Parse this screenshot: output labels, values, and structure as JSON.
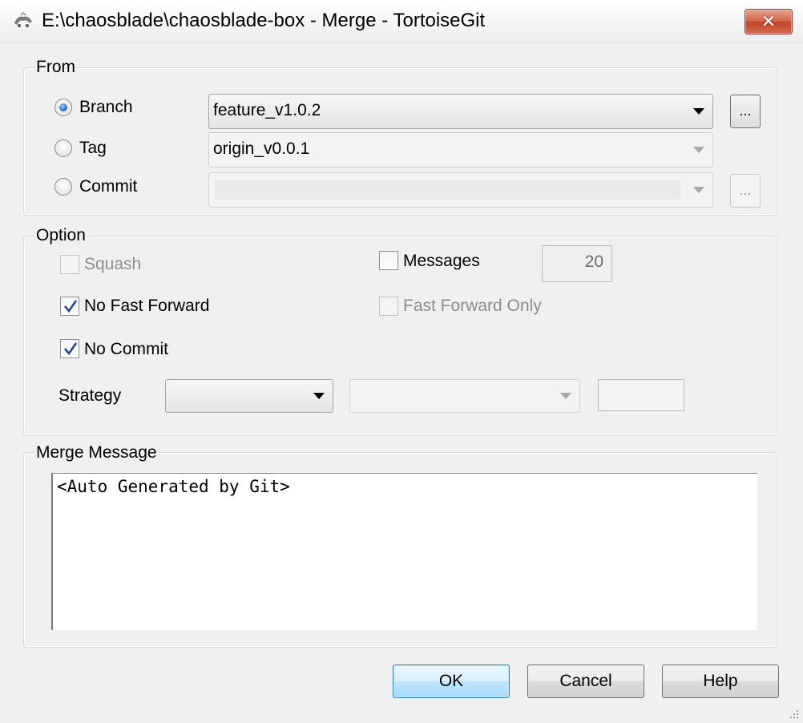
{
  "window": {
    "title": "E:\\chaosblade\\chaosblade-box - Merge - TortoiseGit",
    "close_label": "✕"
  },
  "from": {
    "group_label": "From",
    "branch_label": "Branch",
    "tag_label": "Tag",
    "commit_label": "Commit",
    "branch_value": "feature_v1.0.2",
    "tag_value": "origin_v0.0.1",
    "commit_value": "",
    "browse_label": "...",
    "selected": "Branch"
  },
  "option": {
    "group_label": "Option",
    "squash_label": "Squash",
    "squash_checked": false,
    "no_fast_forward_label": "No Fast Forward",
    "no_fast_forward_checked": true,
    "no_commit_label": "No Commit",
    "no_commit_checked": true,
    "messages_label": "Messages",
    "messages_checked": false,
    "messages_count": "20",
    "fast_forward_only_label": "Fast Forward Only",
    "fast_forward_only_checked": false,
    "strategy_label": "Strategy",
    "strategy_value": "",
    "strategy_option_value": "",
    "strategy_extra_value": ""
  },
  "merge_message": {
    "group_label": "Merge Message",
    "text": "<Auto Generated by Git>"
  },
  "buttons": {
    "ok": "OK",
    "cancel": "Cancel",
    "help": "Help"
  }
}
